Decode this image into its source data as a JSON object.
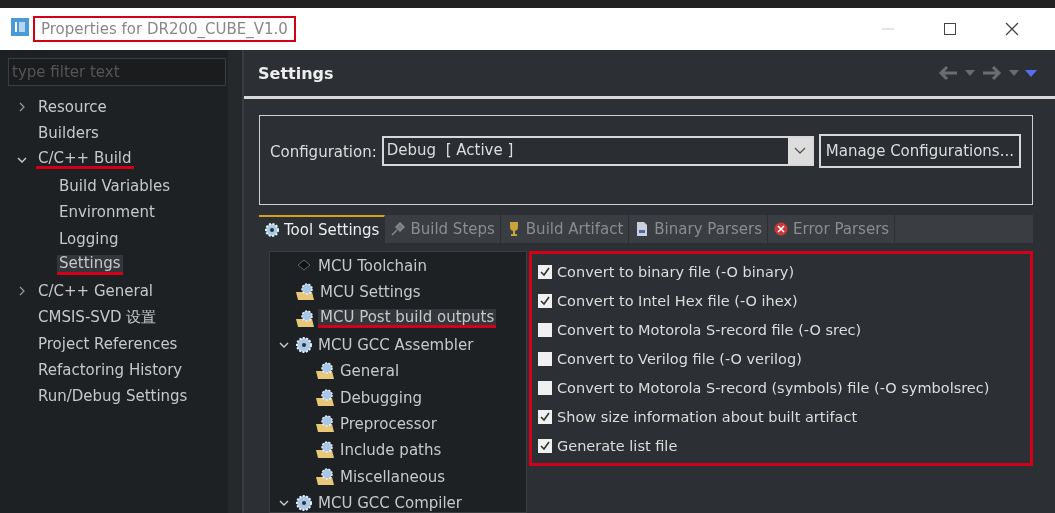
{
  "window": {
    "title": "Properties for DR200_CUBE_V1.0",
    "title_highlighted": true
  },
  "sidebar": {
    "filter": {
      "placeholder": "type filter text"
    },
    "items": [
      {
        "label": "Resource",
        "expanded": false,
        "selected": false,
        "underlined": false
      },
      {
        "label": "Builders",
        "selected": false,
        "underlined": false
      },
      {
        "label": "C/C++ Build",
        "expanded": true,
        "selected": false,
        "underlined": true,
        "children": [
          {
            "label": "Build Variables",
            "selected": false,
            "underlined": false
          },
          {
            "label": "Environment",
            "selected": false,
            "underlined": false
          },
          {
            "label": "Logging",
            "selected": false,
            "underlined": false
          },
          {
            "label": "Settings",
            "selected": true,
            "underlined": true
          }
        ]
      },
      {
        "label": "C/C++ General",
        "expanded": false,
        "selected": false,
        "underlined": false
      },
      {
        "label": "CMSIS-SVD 设置",
        "selected": false,
        "underlined": false
      },
      {
        "label": "Project References",
        "selected": false,
        "underlined": false
      },
      {
        "label": "Refactoring History",
        "selected": false,
        "underlined": false
      },
      {
        "label": "Run/Debug Settings",
        "selected": false,
        "underlined": false
      }
    ]
  },
  "page": {
    "title": "Settings",
    "configuration": {
      "label": "Configuration:",
      "value": "Debug  [ Active ]",
      "button": "Manage Configurations..."
    },
    "tabs": [
      {
        "label": "Tool Settings",
        "kind": "settings",
        "selected": true
      },
      {
        "label": "Build Steps",
        "kind": "steps",
        "selected": false
      },
      {
        "label": "Build Artifact",
        "kind": "artifact",
        "selected": false
      },
      {
        "label": "Binary Parsers",
        "kind": "parsers",
        "selected": false
      },
      {
        "label": "Error Parsers",
        "kind": "errors",
        "selected": false
      }
    ],
    "tool_tree": [
      {
        "label": "MCU Toolchain",
        "kind": "toolchain",
        "selected": false,
        "underlined": false
      },
      {
        "label": "MCU Settings",
        "kind": "category",
        "selected": false,
        "underlined": false
      },
      {
        "label": "MCU Post build outputs",
        "kind": "category",
        "selected": true,
        "underlined": true
      },
      {
        "label": "MCU GCC Assembler",
        "kind": "tool",
        "expanded": true,
        "selected": false,
        "underlined": false,
        "children": [
          {
            "label": "General",
            "kind": "category",
            "selected": false,
            "underlined": false
          },
          {
            "label": "Debugging",
            "kind": "category",
            "selected": false,
            "underlined": false
          },
          {
            "label": "Preprocessor",
            "kind": "category",
            "selected": false,
            "underlined": false
          },
          {
            "label": "Include paths",
            "kind": "category",
            "selected": false,
            "underlined": false
          },
          {
            "label": "Miscellaneous",
            "kind": "category",
            "selected": false,
            "underlined": false
          }
        ]
      },
      {
        "label": "MCU GCC Compiler",
        "kind": "tool",
        "expanded": true,
        "selected": false,
        "underlined": false
      }
    ],
    "options_highlighted": true,
    "options": [
      {
        "label": "Convert to binary file (-O binary)",
        "checked": true
      },
      {
        "label": "Convert to Intel Hex file (-O ihex)",
        "checked": true
      },
      {
        "label": "Convert to Motorola S-record file (-O srec)",
        "checked": false
      },
      {
        "label": "Convert to Verilog file (-O verilog)",
        "checked": false
      },
      {
        "label": "Convert to Motorola S-record (symbols) file (-O symbolsrec)",
        "checked": false
      },
      {
        "label": "Show size information about built artifact",
        "checked": true
      },
      {
        "label": "Generate list file",
        "checked": true
      }
    ]
  }
}
